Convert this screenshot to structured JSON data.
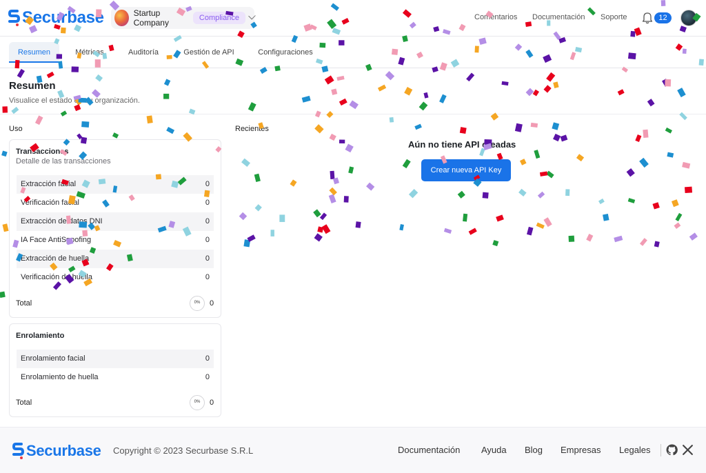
{
  "brand": {
    "name": "Securbase",
    "color": "#1976e8"
  },
  "org": {
    "name": "Startup Company",
    "badge": "Compliance"
  },
  "top_nav": [
    {
      "label": "Comentarios"
    },
    {
      "label": "Documentación"
    },
    {
      "label": "Soporte"
    }
  ],
  "notifications": {
    "count": "12",
    "icon": "bell-icon"
  },
  "tabs": [
    {
      "label": "Resumen",
      "active": true
    },
    {
      "label": "Métricas",
      "active": false
    },
    {
      "label": "Auditoría",
      "active": false
    },
    {
      "label": "Gestión de API",
      "active": false
    },
    {
      "label": "Configuraciones",
      "active": false
    }
  ],
  "page": {
    "title": "Resumen",
    "subtitle": "Visualice el estado de su organización.",
    "usage_label": "Uso",
    "recent_label": "Recientes"
  },
  "transactions": {
    "title": "Transacciones",
    "subtitle": "Detalle de las transacciones",
    "rows": [
      {
        "label": "Extracción facial",
        "value": "0"
      },
      {
        "label": "Verificación facial",
        "value": "0"
      },
      {
        "label": "Extracción de datos DNI",
        "value": "0"
      },
      {
        "label": "IA Face AntiSpoofing",
        "value": "0"
      },
      {
        "label": "Extracción de huella",
        "value": "0"
      },
      {
        "label": "Verificación de huella",
        "value": "0"
      }
    ],
    "total_label": "Total",
    "total_percent": "0%",
    "total_value": "0"
  },
  "enrollment": {
    "title": "Enrolamiento",
    "rows": [
      {
        "label": "Enrolamiento facial",
        "value": "0"
      },
      {
        "label": "Enrolamiento de huella",
        "value": "0"
      }
    ],
    "total_label": "Total",
    "total_percent": "0%",
    "total_value": "0"
  },
  "empty_state": {
    "message": "Aún no tiene API creadas",
    "button_label": "Crear nueva API Key",
    "button_color": "#1a73e8"
  },
  "footer": {
    "brand": "Securbase",
    "copyright": "Copyright © 2023 Securbase S.R.L",
    "links": [
      {
        "label": "Documentación"
      },
      {
        "label": "Ayuda"
      },
      {
        "label": "Blog"
      },
      {
        "label": "Empresas"
      },
      {
        "label": "Legales"
      }
    ],
    "icons": [
      "github-icon",
      "x-twitter-icon"
    ]
  },
  "confetti_colors": [
    "#e8001c",
    "#1f9e3d",
    "#f5a623",
    "#5b13a6",
    "#1d8fd0",
    "#f19bb3",
    "#b48ee6",
    "#8fd3e0"
  ]
}
